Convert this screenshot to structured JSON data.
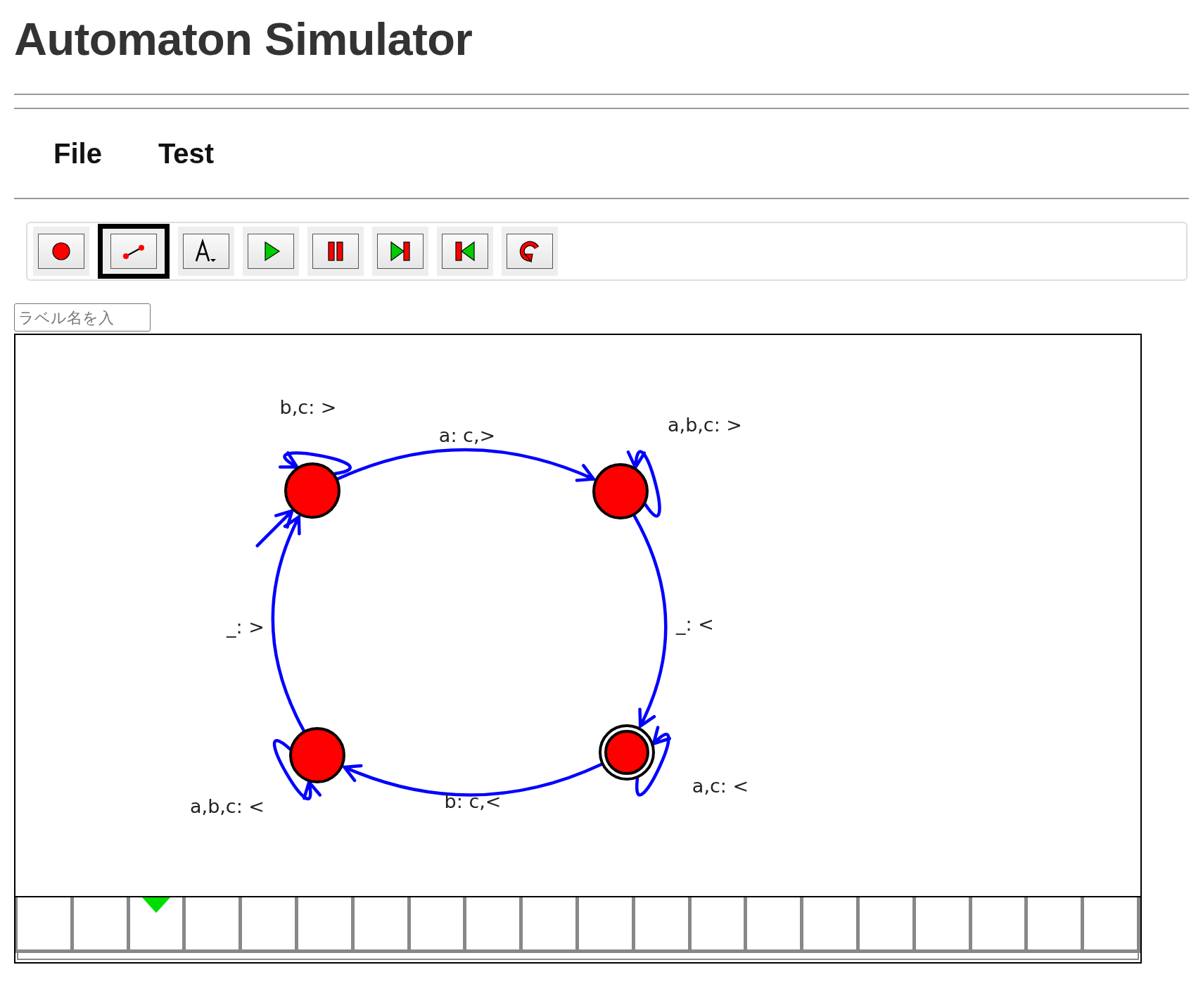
{
  "title": "Automaton Simulator",
  "menu": [
    {
      "label": "File"
    },
    {
      "label": "Test"
    }
  ],
  "toolbar": [
    {
      "kind": "state",
      "selected": false
    },
    {
      "kind": "transition",
      "selected": true
    },
    {
      "kind": "label",
      "selected": false
    },
    {
      "kind": "play",
      "selected": false
    },
    {
      "kind": "pause",
      "selected": false
    },
    {
      "kind": "step-forward",
      "selected": false
    },
    {
      "kind": "step-back",
      "selected": false
    },
    {
      "kind": "reset",
      "selected": false
    }
  ],
  "label_field": {
    "placeholder": "ラベル名を入"
  },
  "diagram": {
    "states": [
      {
        "initial": true,
        "accepting": false
      },
      {
        "initial": false,
        "accepting": false
      },
      {
        "initial": false,
        "accepting": true
      },
      {
        "initial": false,
        "accepting": false
      }
    ],
    "transitions": [
      {
        "kind": "loop",
        "label": "b,c: >"
      },
      {
        "kind": "edge",
        "label": "a: c,>"
      },
      {
        "kind": "loop",
        "label": "a,b,c: >"
      },
      {
        "kind": "edge",
        "label": "_: <"
      },
      {
        "kind": "loop",
        "label": "a,c: <"
      },
      {
        "kind": "edge",
        "label": "b: c,<"
      },
      {
        "kind": "loop",
        "label": "a,b,c: <"
      },
      {
        "kind": "edge",
        "label": "_: >"
      }
    ]
  },
  "tape": {
    "cells": [
      {
        "head": false
      },
      {
        "head": false
      },
      {
        "head": true
      },
      {
        "head": false
      },
      {
        "head": false
      },
      {
        "head": false
      },
      {
        "head": false
      },
      {
        "head": false
      },
      {
        "head": false
      },
      {
        "head": false
      },
      {
        "head": false
      },
      {
        "head": false
      },
      {
        "head": false
      },
      {
        "head": false
      },
      {
        "head": false
      },
      {
        "head": false
      },
      {
        "head": false
      },
      {
        "head": false
      },
      {
        "head": false
      },
      {
        "head": false
      }
    ]
  }
}
